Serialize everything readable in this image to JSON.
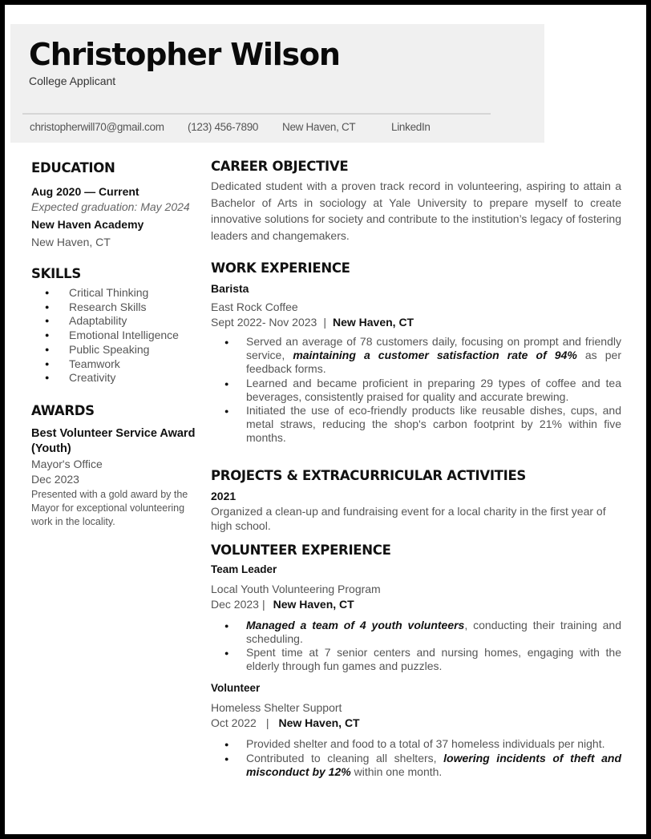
{
  "header": {
    "name": "Christopher Wilson",
    "role": "College Applicant",
    "contact": {
      "email": "christopherwill70@gmail.com",
      "phone": "(123) 456-7890",
      "location": "New Haven, CT",
      "linkedin": "LinkedIn"
    }
  },
  "education": {
    "heading": "EDUCATION",
    "dates": "Aug 2020 — Current",
    "expected": "Expected graduation: May 2024",
    "school": "New Haven Academy",
    "location": "New Haven, CT"
  },
  "skills": {
    "heading": "SKILLS",
    "items": [
      "Critical Thinking",
      "Research Skills",
      "Adaptability",
      "Emotional Intelligence",
      "Public Speaking",
      "Teamwork",
      "Creativity"
    ]
  },
  "awards": {
    "heading": "AWARDS",
    "title": "Best Volunteer Service Award (Youth)",
    "issuer": "Mayor's Office",
    "date": "Dec 2023",
    "description": "Presented with a gold award by the Mayor for exceptional volunteering work in the locality."
  },
  "objective": {
    "heading": "CAREER OBJECTIVE",
    "text": "Dedicated student with a proven track record in volunteering, aspiring to attain a Bachelor of Arts in sociology at Yale University to prepare myself to create innovative solutions for society and contribute to the institution’s legacy of fostering leaders and changemakers."
  },
  "work": {
    "heading": "WORK EXPERIENCE",
    "title": "Barista",
    "company": "East Rock Coffee",
    "dates": "Sept 2022- Nov 2023",
    "separator": "|",
    "location": "New Haven, CT",
    "bullets": [
      {
        "pre": "Served an average of 78 customers daily, focusing on prompt and friendly service, ",
        "bold": "maintaining a customer satisfaction rate of 94%",
        "post": " as per feedback forms."
      },
      {
        "pre": "Learned and became proficient in preparing 29 types of coffee and tea beverages, consistently praised for quality and accurate brewing.",
        "bold": "",
        "post": ""
      },
      {
        "pre": "Initiated the use of eco-friendly products like reusable dishes, cups, and metal straws, reducing the shop's carbon footprint by 21% within five months.",
        "bold": "",
        "post": ""
      }
    ]
  },
  "projects": {
    "heading": "PROJECTS & EXTRACURRICULAR ACTIVITIES",
    "year": "2021",
    "text": "Organized a clean-up and fundraising event for a local charity in the first year of high school."
  },
  "volunteer": {
    "heading": "VOLUNTEER EXPERIENCE",
    "roles": [
      {
        "title": "Team Leader",
        "org": "Local Youth Volunteering Program",
        "dates": "Dec 2023",
        "separator": "|",
        "location": "New Haven, CT",
        "bullets": [
          {
            "pre": "",
            "bold": "Managed a team of 4 youth volunteers",
            "post": ", conducting their training and scheduling."
          },
          {
            "pre": "Spent time at 7 senior centers and nursing homes, engaging with the elderly through fun games and puzzles.",
            "bold": "",
            "post": ""
          }
        ]
      },
      {
        "title": "Volunteer",
        "org": "Homeless Shelter Support",
        "dates": "Oct 2022",
        "separator": "|",
        "location": "New Haven, CT",
        "bullets": [
          {
            "pre": "Provided shelter and food to a total of 37 homeless individuals per night.",
            "bold": "",
            "post": ""
          },
          {
            "pre": "Contributed to cleaning all shelters, ",
            "bold": "lowering incidents of theft and misconduct by 12%",
            "post": " within one month."
          }
        ]
      }
    ]
  }
}
